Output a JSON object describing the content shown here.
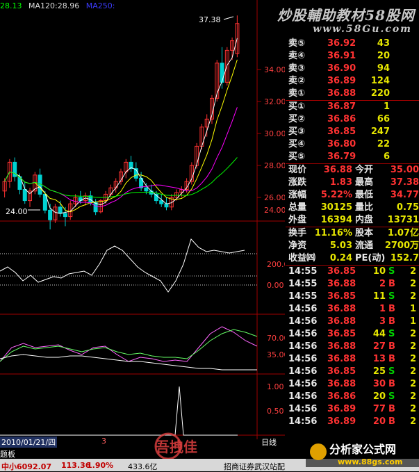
{
  "legend": {
    "close": "28.13",
    "ma120": "MA120:28.96",
    "ma250": "MA250:"
  },
  "watermark": {
    "title": "炒股輔助教材58股网",
    "url": "www.58Gu.com"
  },
  "price_axis": [
    "34.00",
    "32.00",
    "30.00",
    "28.00",
    "26.00",
    "24.00"
  ],
  "macd_axis": [
    "200.00",
    "0.00"
  ],
  "kdj_axis": [
    "70.00",
    "35.00"
  ],
  "vol_axis": [
    "1.00",
    "0.50"
  ],
  "annot": {
    "high": "37.38",
    "low": "24.00"
  },
  "dates": {
    "left": "2010/01/21/四",
    "right_mark": "3"
  },
  "tab": "日线",
  "board_label": "题板",
  "order_book": {
    "sells": [
      {
        "label": "卖⑤",
        "price": "36.92",
        "vol": "43"
      },
      {
        "label": "卖④",
        "price": "36.91",
        "vol": "20"
      },
      {
        "label": "卖③",
        "price": "36.90",
        "vol": "94"
      },
      {
        "label": "卖②",
        "price": "36.89",
        "vol": "124"
      },
      {
        "label": "卖①",
        "price": "36.88",
        "vol": "220"
      }
    ],
    "buys": [
      {
        "label": "买①",
        "price": "36.87",
        "vol": "1"
      },
      {
        "label": "买②",
        "price": "36.86",
        "vol": "66"
      },
      {
        "label": "买③",
        "price": "36.85",
        "vol": "247"
      },
      {
        "label": "买④",
        "price": "36.80",
        "vol": "22"
      },
      {
        "label": "买⑤",
        "price": "36.79",
        "vol": "6"
      }
    ]
  },
  "quote": [
    {
      "l1": "现价",
      "v1": "36.88",
      "l2": "今开",
      "v2": "35.00"
    },
    {
      "l1": "涨跌",
      "v1": "1.83",
      "l2": "最高",
      "v2": "37.38"
    },
    {
      "l1": "涨幅",
      "v1": "5.22%",
      "l2": "最低",
      "v2": "34.77"
    },
    {
      "l1": "总量",
      "v1": "30125",
      "l2": "量比",
      "v2": "0.75"
    },
    {
      "l1": "外盘",
      "v1": "16394",
      "l2": "内盘",
      "v2": "13731"
    }
  ],
  "stats": [
    {
      "l1": "换手",
      "v1": "11.16%",
      "l2": "股本",
      "v2": "1.07亿"
    },
    {
      "l1": "净资",
      "v1": "5.03",
      "l2": "流通",
      "v2": "2700万"
    },
    {
      "l1": "收益㈣",
      "v1": "0.24",
      "l2": "PE(动)",
      "v2": "152.7"
    }
  ],
  "ticks": [
    {
      "t": "14:55",
      "p": "36.85",
      "v": "10",
      "d": "S",
      "n": "2"
    },
    {
      "t": "14:55",
      "p": "36.88",
      "v": "2",
      "d": "B",
      "n": "2"
    },
    {
      "t": "14:55",
      "p": "36.85",
      "v": "11",
      "d": "S",
      "n": "2"
    },
    {
      "t": "14:56",
      "p": "36.88",
      "v": "1",
      "d": "B",
      "n": "1"
    },
    {
      "t": "14:56",
      "p": "36.88",
      "v": "3",
      "d": "B",
      "n": "1"
    },
    {
      "t": "14:56",
      "p": "36.85",
      "v": "44",
      "d": "S",
      "n": "2"
    },
    {
      "t": "14:56",
      "p": "36.88",
      "v": "27",
      "d": "B",
      "n": "2"
    },
    {
      "t": "14:56",
      "p": "36.88",
      "v": "13",
      "d": "B",
      "n": "2"
    },
    {
      "t": "14:56",
      "p": "36.85",
      "v": "25",
      "d": "S",
      "n": "2"
    },
    {
      "t": "14:56",
      "p": "36.88",
      "v": "30",
      "d": "B",
      "n": "2"
    },
    {
      "t": "14:56",
      "p": "36.86",
      "v": "20",
      "d": "S",
      "n": "2"
    },
    {
      "t": "14:56",
      "p": "36.89",
      "v": "77",
      "d": "B",
      "n": "2"
    },
    {
      "t": "14:56",
      "p": "36.89",
      "v": "20",
      "d": "B",
      "n": "2"
    }
  ],
  "status": {
    "index": "中小6092.07",
    "change": "113.36",
    "pct": "1.90%",
    "amount": "433.6亿",
    "broker": "招商证券武汉站配"
  },
  "logos": {
    "left": "吾拽佳",
    "right": "分析家公式网",
    "right_url": "www.88gs.com"
  },
  "colors": {
    "up": "#ff3232",
    "down": "#00d2d2",
    "neutral": "#e6e600",
    "grid": "#a00000",
    "ma5": "#ffffff",
    "ma10": "#ffff00",
    "ma20": "#ff00ff",
    "ma60": "#00ff00"
  }
}
